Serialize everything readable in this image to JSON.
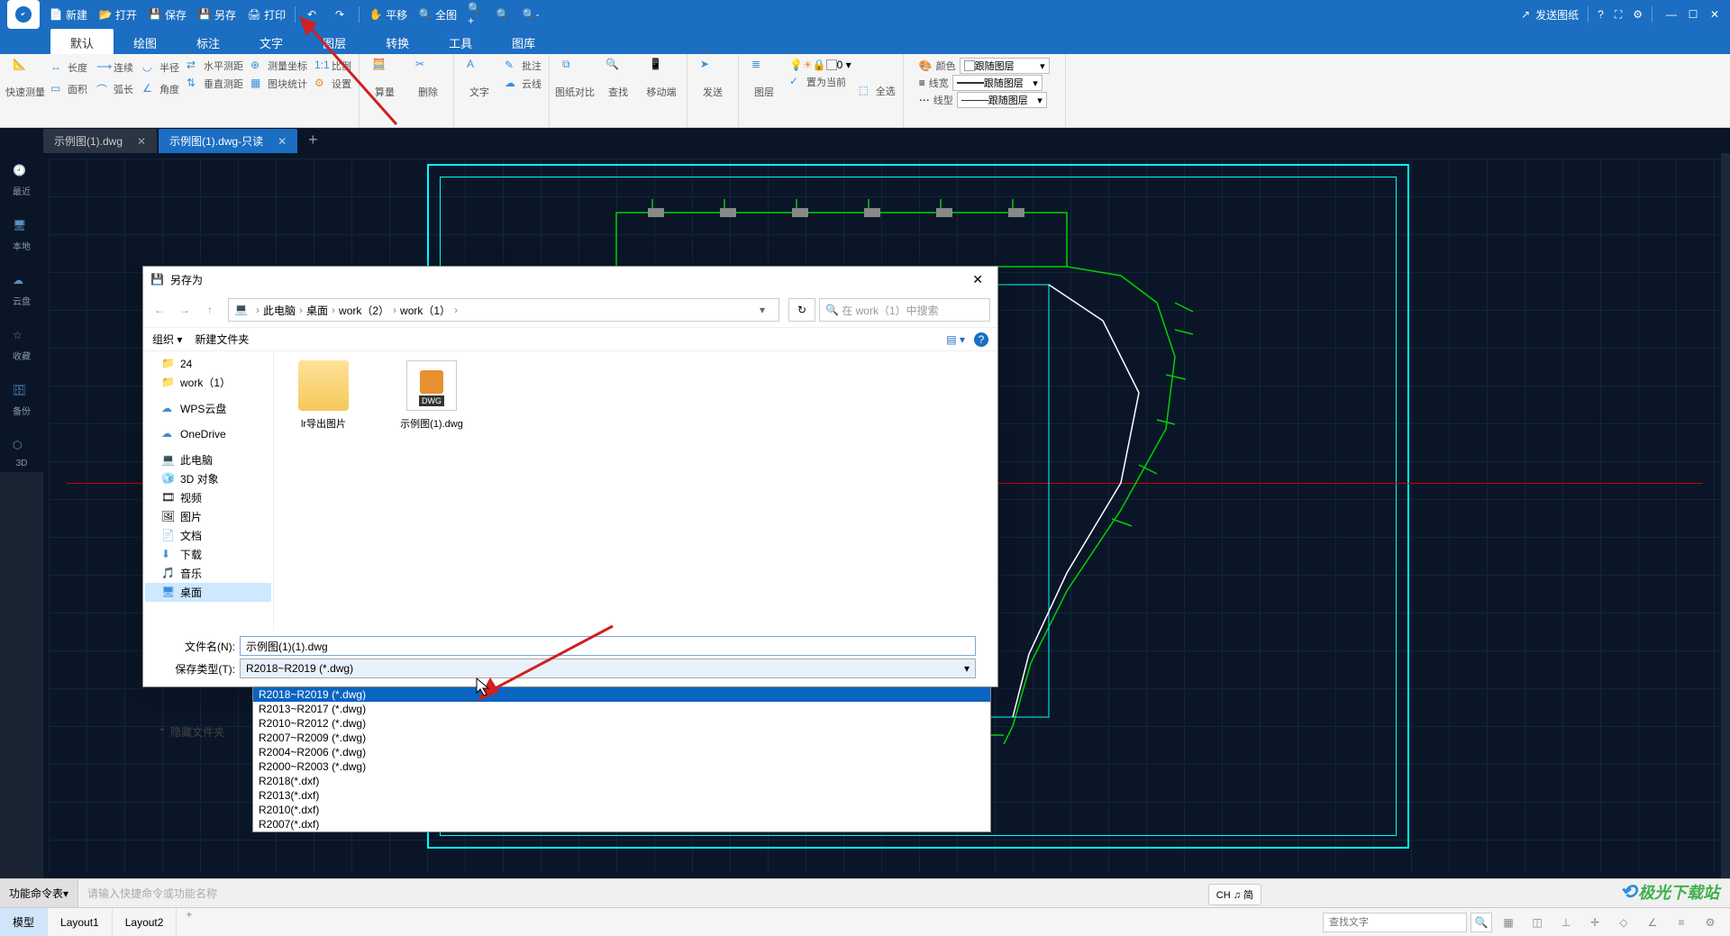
{
  "top_menu": {
    "new": "新建",
    "open": "打开",
    "save": "保存",
    "saveas": "另存",
    "print": "打印",
    "pan": "平移",
    "full": "全图",
    "send": "发送图纸"
  },
  "ribbon_tabs": [
    "默认",
    "绘图",
    "标注",
    "文字",
    "图层",
    "转换",
    "工具",
    "图库"
  ],
  "ribbon": {
    "quickmeasure": "快速测量",
    "length": "长度",
    "continuous": "连续",
    "radius": "半径",
    "hlevel": "水平测距",
    "area": "面积",
    "arc": "弧长",
    "angle": "角度",
    "vlevel": "垂直测距",
    "coord": "测量坐标",
    "scale": "比例",
    "blockstat": "图块统计",
    "settings": "设置",
    "calc": "算量",
    "delete": "删除",
    "text": "文字",
    "anno": "批注",
    "cloud": "云线",
    "compare": "图纸对比",
    "find": "查找",
    "mobile": "移动端",
    "send": "发送",
    "layer": "图层",
    "setcurrent": "置为当前",
    "selectall": "全选",
    "color": "颜色",
    "lineweight": "线宽",
    "linetype": "线型",
    "bylayer": "跟随图层"
  },
  "file_tabs": [
    {
      "name": "示例图(1).dwg",
      "active": false
    },
    {
      "name": "示例图(1).dwg-只读",
      "active": true
    }
  ],
  "sidebar": [
    {
      "label": "最近"
    },
    {
      "label": "本地"
    },
    {
      "label": "云盘"
    },
    {
      "label": "收藏"
    },
    {
      "label": "备份"
    },
    {
      "label": "3D"
    }
  ],
  "dialog": {
    "title": "另存为",
    "breadcrumb": [
      "此电脑",
      "桌面",
      "work（2）",
      "work（1）"
    ],
    "search_placeholder": "在 work（1）中搜索",
    "organize": "组织",
    "newfolder": "新建文件夹",
    "tree": [
      {
        "label": "24",
        "icon": "folder"
      },
      {
        "label": "work（1）",
        "icon": "folder"
      },
      {
        "label": "WPS云盘",
        "icon": "cloud"
      },
      {
        "label": "OneDrive",
        "icon": "cloud"
      },
      {
        "label": "此电脑",
        "icon": "pc"
      },
      {
        "label": "3D 对象",
        "icon": "3d"
      },
      {
        "label": "视频",
        "icon": "video"
      },
      {
        "label": "图片",
        "icon": "image"
      },
      {
        "label": "文档",
        "icon": "doc"
      },
      {
        "label": "下载",
        "icon": "download"
      },
      {
        "label": "音乐",
        "icon": "music"
      },
      {
        "label": "桌面",
        "icon": "desktop"
      }
    ],
    "files": [
      {
        "label": "lr导出图片",
        "type": "folder"
      },
      {
        "label": "示例图(1).dwg",
        "type": "dwg"
      }
    ],
    "filename_label": "文件名(N):",
    "filename_value": "示例图(1)(1).dwg",
    "filetype_label": "保存类型(T):",
    "filetype_value": "R2018~R2019 (*.dwg)",
    "type_options": [
      "R2018~R2019 (*.dwg)",
      "R2013~R2017 (*.dwg)",
      "R2010~R2012 (*.dwg)",
      "R2007~R2009 (*.dwg)",
      "R2004~R2006 (*.dwg)",
      "R2000~R2003 (*.dwg)",
      "R2018(*.dxf)",
      "R2013(*.dxf)",
      "R2010(*.dxf)",
      "R2007(*.dxf)"
    ],
    "hide_folders": "隐藏文件夹"
  },
  "cmd": {
    "label": "功能命令表",
    "placeholder": "请输入快捷命令或功能名称"
  },
  "ime": "CH ♫ 简",
  "layouts": [
    "模型",
    "Layout1",
    "Layout2"
  ],
  "status": {
    "find_placeholder": "查找文字"
  },
  "watermark": "极光下载站"
}
